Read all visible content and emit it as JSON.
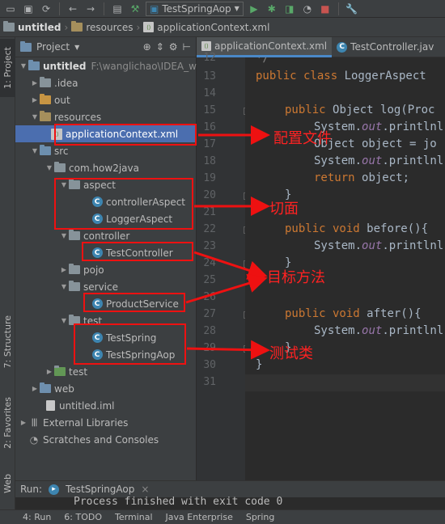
{
  "toolbar": {
    "run_config": "TestSpringAop",
    "icons": [
      "save-icon",
      "sync-icon",
      "back-icon",
      "forward-icon",
      "project-structure-icon",
      "build-icon",
      "run-icon",
      "debug-icon",
      "coverage-icon",
      "stop-icon",
      "wrench-icon"
    ]
  },
  "breadcrumb": {
    "project": "untitled",
    "folder": "resources",
    "file": "applicationContext.xml"
  },
  "left_strip": {
    "project_tab": "1: Project",
    "structure_tab": "7: Structure",
    "favorites_tab": "2: Favorites",
    "web_tab": "Web"
  },
  "project_panel": {
    "title": "Project",
    "tree": {
      "root": "untitled",
      "root_path": "F:\\wanglichao\\IDEA_w",
      "idea": ".idea",
      "out": "out",
      "resources": "resources",
      "app_context": "applicationContext.xml",
      "src": "src",
      "pkg": "com.how2java",
      "aspect": "aspect",
      "controllerAspect": "controllerAspect",
      "LoggerAspect": "LoggerAspect",
      "controller": "controller",
      "TestController": "TestController",
      "pojo": "pojo",
      "service": "service",
      "ProductService": "ProductService",
      "test_pkg": "test",
      "TestSpring": "TestSpring",
      "TestSpringAop": "TestSpringAop",
      "test_dir": "test",
      "web": "web",
      "iml": "untitled.iml",
      "ext_libs": "External Libraries",
      "scratches": "Scratches and Consoles"
    }
  },
  "editor": {
    "tabs": [
      "applicationContext.xml",
      "TestController.jav"
    ],
    "lines": {
      "n12": "12",
      "n13": "13",
      "n14": "14",
      "n15": "15",
      "n16": "16",
      "n17": "17",
      "n18": "18",
      "n19": "19",
      "n20": "20",
      "n21": "21",
      "n22": "22",
      "n23": "23",
      "n24": "24",
      "n25": "25",
      "n26": "26",
      "n27": "27",
      "n28": "28",
      "n29": "29",
      "n30": "30",
      "n31": "31"
    },
    "code": {
      "l12": "*/",
      "l13_kw": "public class ",
      "l13_rest": "LoggerAspect",
      "l15_kw": "public ",
      "l15_rest": "Object log(Proc",
      "l16_a": "System.",
      "l16_f": "out",
      "l16_b": ".printlnl",
      "l17": "Object object = jo",
      "l18_a": "System.",
      "l18_f": "out",
      "l18_b": ".printlnl",
      "l19_kw": "return ",
      "l19_rest": "object;",
      "l20": "}",
      "l22_kw": "public void ",
      "l22_rest": "before(){",
      "l23_a": "System.",
      "l23_f": "out",
      "l23_b": ".printlnl",
      "l24": "}",
      "l26_kw": "public void ",
      "l26_rest": "after(){",
      "l27_a": "System.",
      "l27_f": "out",
      "l27_b": ".printlnl",
      "l28": "}",
      "l29": "}"
    }
  },
  "run_panel": {
    "label": "Run:",
    "config": "TestSpringAop",
    "output": "Process finished with exit code 0"
  },
  "bottom_bar": {
    "run": "4: Run",
    "todo": "6: TODO",
    "terminal": "Terminal",
    "java_ee": "Java Enterprise",
    "spring": "Spring"
  },
  "annotations": {
    "config_file": "配置文件",
    "aspect": "切面",
    "target_method": "目标方法",
    "test_class": "测试类"
  },
  "colors": {
    "annotation_red": "#ee1111",
    "selection_blue": "#4b6eaf",
    "keyword": "#cc7832",
    "field": "#9876aa"
  }
}
